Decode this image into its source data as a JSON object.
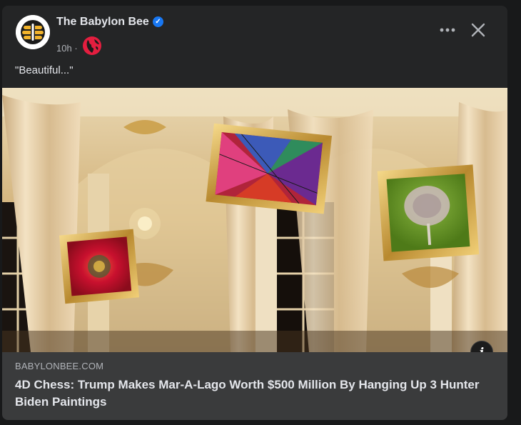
{
  "post": {
    "page_name": "The Babylon Bee",
    "time": "10h",
    "separator": "·",
    "text": "\"Beautiful...\""
  },
  "link": {
    "domain": "BABYLONBEE.COM",
    "title": "4D Chess: Trump Makes Mar-A-Lago Worth $500 Million By Hanging Up 3 Hunter Biden Paintings"
  },
  "icons": {
    "verified": "verified-badge",
    "privacy": "globe-icon",
    "more": "more-horizontal-icon",
    "close": "close-icon",
    "info": "info-icon"
  },
  "colors": {
    "card_bg": "#242526",
    "link_bg": "#3a3b3c",
    "verified_blue": "#1877f2",
    "globe_red": "#e41e3f"
  }
}
